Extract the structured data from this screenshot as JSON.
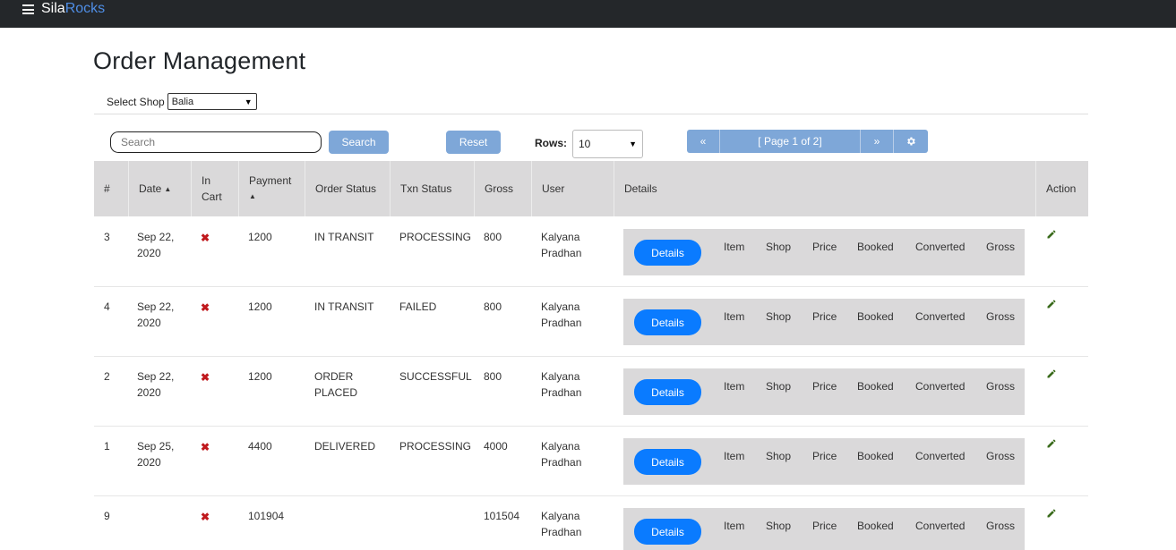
{
  "brand": {
    "part1": "Sila",
    "part2": "Rocks"
  },
  "page_title": "Order Management",
  "shop": {
    "label": "Select Shop",
    "selected": "Balia"
  },
  "search": {
    "placeholder": "Search",
    "button": "Search"
  },
  "reset_label": "Reset",
  "rows": {
    "label": "Rows:",
    "value": "10"
  },
  "pager": {
    "first": "«",
    "info": "[ Page 1 of 2]",
    "next": "»"
  },
  "columns": {
    "num": "#",
    "date": "Date",
    "in_cart_1": "In",
    "in_cart_2": "Cart",
    "payment": "Payment",
    "order_status": "Order Status",
    "txn_status": "Txn Status",
    "gross": "Gross",
    "user": "User",
    "details": "Details",
    "action": "Action"
  },
  "detail_headers": {
    "button": "Details",
    "item": "Item",
    "shop": "Shop",
    "price": "Price",
    "booked": "Booked",
    "converted": "Converted",
    "gross": "Gross"
  },
  "incart_mark": "✖",
  "colors": {
    "topbar": "#24272a",
    "brand_accent": "#4f8ee6",
    "primary": "#0a7bff",
    "light_button": "#7ea7d8",
    "header_bg": "#dad9da",
    "incart_no": "#c0191d",
    "edit_icon": "#3a6b1c"
  },
  "orders": [
    {
      "num": "3",
      "date1": "Sep 22,",
      "date2": "2020",
      "payment": "1200",
      "status1": "IN TRANSIT",
      "status2": "",
      "txn": "PROCESSING",
      "gross": "800",
      "user1": "Kalyana",
      "user2": "Pradhan"
    },
    {
      "num": "4",
      "date1": "Sep 22,",
      "date2": "2020",
      "payment": "1200",
      "status1": "IN TRANSIT",
      "status2": "",
      "txn": "FAILED",
      "gross": "800",
      "user1": "Kalyana",
      "user2": "Pradhan"
    },
    {
      "num": "2",
      "date1": "Sep 22,",
      "date2": "2020",
      "payment": "1200",
      "status1": "ORDER",
      "status2": "PLACED",
      "txn": "SUCCESSFUL",
      "gross": "800",
      "user1": "Kalyana",
      "user2": "Pradhan"
    },
    {
      "num": "1",
      "date1": "Sep 25,",
      "date2": "2020",
      "payment": "4400",
      "status1": "DELIVERED",
      "status2": "",
      "txn": "PROCESSING",
      "gross": "4000",
      "user1": "Kalyana",
      "user2": "Pradhan"
    },
    {
      "num": "9",
      "date1": "",
      "date2": "",
      "payment": "101904",
      "status1": "",
      "status2": "",
      "txn": "",
      "gross": "101504",
      "user1": "Kalyana",
      "user2": "Pradhan"
    }
  ]
}
